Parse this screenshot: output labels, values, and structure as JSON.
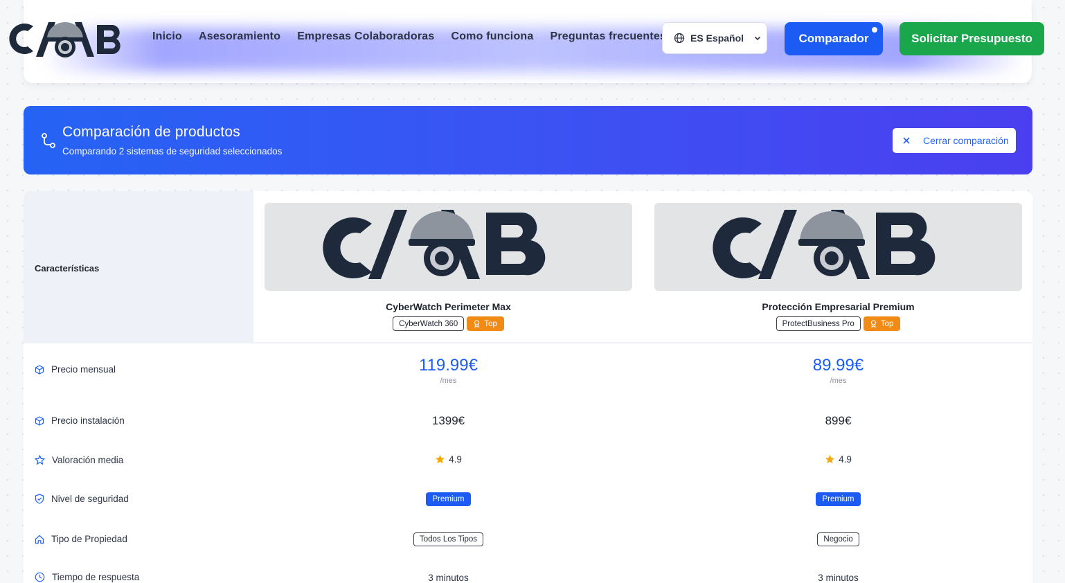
{
  "header": {
    "logo_text": "CAB",
    "nav": [
      "Inicio",
      "Asesoramiento",
      "Empresas Colaboradoras",
      "Como funciona",
      "Preguntas frecuentes"
    ],
    "language": "ES Español",
    "compare_button": "Comparador",
    "quote_button": "Solicitar Presupuesto"
  },
  "banner": {
    "title": "Comparación de productos",
    "subtitle": "Comparando 2 sistemas de seguridad seleccionados",
    "close_button": "Cerrar comparación"
  },
  "table": {
    "features_header": "Características",
    "products": [
      {
        "name": "CyberWatch Perimeter Max",
        "brand": "CyberWatch 360",
        "badge": "Top"
      },
      {
        "name": "Protección Empresarial Premium",
        "brand": "ProtectBusiness Pro",
        "badge": "Top"
      }
    ],
    "rows": {
      "monthly_price": {
        "label": "Precio mensual",
        "values": [
          "119.99€",
          "89.99€"
        ],
        "unit": "/mes"
      },
      "install_price": {
        "label": "Precio instalación",
        "values": [
          "1399€",
          "899€"
        ]
      },
      "rating": {
        "label": "Valoración media",
        "values": [
          "4.9",
          "4.9"
        ]
      },
      "security_level": {
        "label": "Nivel de seguridad",
        "values": [
          "Premium",
          "Premium"
        ]
      },
      "property_type": {
        "label": "Tipo de Propiedad",
        "values": [
          "Todos Los Tipos",
          "Negocio"
        ]
      },
      "response_time": {
        "label": "Tiempo de respuesta",
        "values": [
          "3 minutos",
          "3 minutos"
        ]
      }
    }
  },
  "colors": {
    "primary_blue": "#1c5cf5",
    "green": "#1aa64a",
    "orange": "#f28a16",
    "navy_logo": "#1e2a3c"
  }
}
